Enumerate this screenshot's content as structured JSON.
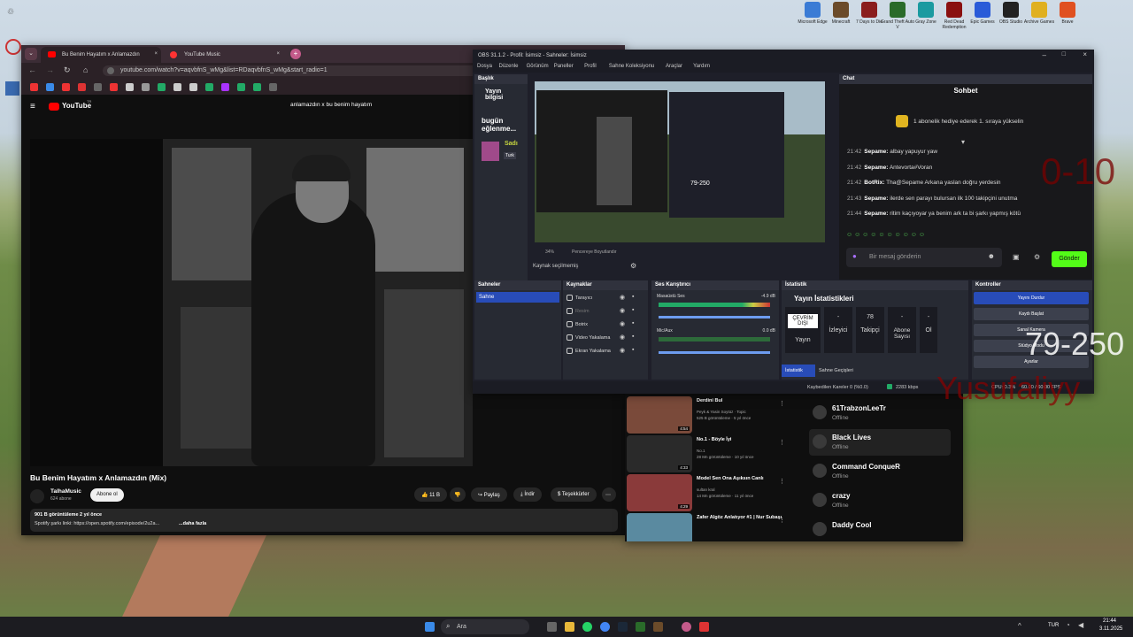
{
  "desktop": {
    "icons": [
      {
        "label": "Microsoft Edge",
        "color": "#3a7bd5"
      },
      {
        "label": "Minecraft",
        "color": "#6b4b2a"
      },
      {
        "label": "7 Days to Die",
        "color": "#8a1d1d"
      },
      {
        "label": "Grand Theft Auto V",
        "color": "#2a6b2a"
      },
      {
        "label": "Gray Zone",
        "color": "#1a9aa0"
      },
      {
        "label": "Red Dead Redemption",
        "color": "#8a1010"
      },
      {
        "label": "Epic Games",
        "color": "#2a5bd8"
      },
      {
        "label": "OBS Studio",
        "color": "#222"
      },
      {
        "label": "Archive Games",
        "color": "#e0b020"
      },
      {
        "label": "Brave",
        "color": "#e05020"
      }
    ]
  },
  "browser": {
    "tab1": "Bu Benim Hayatım x Anlamazdın",
    "tab2": "YouTube Music",
    "url": "youtube.com/watch?v=aqvbfnS_wMg&list=RDaqvbfnS_wMg&start_radio=1",
    "yt_logo": "YouTube",
    "yt_country": "TR",
    "playlist_title": "anlamazdın x bu benim hayatım",
    "video_title": "Bu Benim Hayatım x Anlamazdın (Mix)",
    "channel": "TalhaMusic",
    "subs": "624 abone",
    "subscribe": "Abone ol",
    "likes": "11 B",
    "share": "Paylaş",
    "download": "İndir",
    "thanks": "Teşekkürler",
    "views": "901 B görüntüleme  2 yıl önce",
    "desc": "Spotify şarkı linki: https://open.spotify.com/episode/2u2a...",
    "more": "...daha fazla"
  },
  "obs": {
    "title": "OBS 31.1.2 - Profil: İsimsiz - Sahneler: İsimsiz",
    "menu": [
      "Dosya",
      "Düzenle",
      "Görünüm",
      "Paneller",
      "Profil",
      "Sahne Koleksiyonu",
      "Araçlar",
      "Yardım"
    ],
    "baslik": "Başlık",
    "yayin_bilgisi": "Yayın bilgisi",
    "bugun": "bugün eğlenme...",
    "side_label1": "Sadı",
    "side_label2": "Turk",
    "zoom": "34%",
    "window_size": "Pencereye Boyutlandır",
    "no_source": "Kaynak seçilmemiş",
    "scenes_h": "Sahneler",
    "scene1": "Sahne",
    "sources_h": "Kaynaklar",
    "sources": [
      "Tarayıcı",
      "Resim",
      "Botrix",
      "Video Yakalama",
      "Ekran Yakalama"
    ],
    "mixer_h": "Ses Karıştırıcı",
    "mix1": "Masaüstü Ses",
    "mix1db": "-4.9 dB",
    "mix2": "Mic/Aux",
    "mix2db": "0.0 dB",
    "stats_h": "İstatistik",
    "stats_title": "Yayın İstatistikleri",
    "stat_status": "ÇEVRİM DIŞI",
    "stat_yayin": "Yayın",
    "stat1v": "-",
    "stat1l": "İzleyici",
    "stat2v": "78",
    "stat2l": "Takipçi",
    "stat3v": "-",
    "stat3l": "Abone Sayısı",
    "stat4v": "-",
    "stat4l": "Ol",
    "tab_stats": "İstatistik",
    "tab_trans": "Sahne Geçişleri",
    "controls_h": "Kontroller",
    "controls": [
      "Yayını Durdur",
      "Kaydı Başlat",
      "Sanal Kamera",
      "Stüdyo Modu",
      "Ayarlar"
    ],
    "status_bar": "Kaybedilen Kareler 0 (%0.0)",
    "kbps": "2283 kbps",
    "cpu": "CPU: 0.3%",
    "fps": "60.00 / 60.00 FPS"
  },
  "chat": {
    "header": "Chat",
    "title": "Sohbet",
    "banner": "1 abonelik hediye ederek 1. sıraya yükselin",
    "messages": [
      {
        "time": "21:42",
        "name": "Sepame:",
        "text": "albay yapuyur yaw"
      },
      {
        "time": "21:42",
        "name": "Sepame:",
        "text": "Antevorta#Voran"
      },
      {
        "time": "21:42",
        "name": "BotRix:",
        "text": "Tha@Sepame Arkana yaslan doğru yerdesin"
      },
      {
        "time": "21:43",
        "name": "Sepame:",
        "text": "ilerde sen parayı bulursan ilk 100 takipçini unutma"
      },
      {
        "time": "21:44",
        "name": "Sepame:",
        "text": "ritim kaçıyoyar ya benim ark ta bi şarkı yapmış kötü"
      }
    ],
    "placeholder": "Bir mesaj gönderin",
    "send": "Gönder"
  },
  "overlay": {
    "range1": "0-10",
    "range2": "79-250",
    "name": "Yusufaliyy"
  },
  "suggestions": [
    {
      "title": "Derdini Bul",
      "sub": "Peyk & Yasin Soytüz · Topic\n525 B görüntüleme · 5 yıl önce",
      "dur": "4:54",
      "color": "#7a4a3a"
    },
    {
      "title": "No.1 - Böyle İyi",
      "sub": "No.1\n28 Mn görüntüleme · 10 yıl önce",
      "dur": "4:33",
      "color": "#2a2a2a"
    },
    {
      "title": "Model  Sen Ona Aşıksın Canlı",
      "sub": "sultan kral\n14 Mn görüntüleme · 11 yıl önce",
      "dur": "4:29",
      "color": "#8a3a3a"
    },
    {
      "title": "Zafer Algöz Anlatıyor #1 | Nur Subaşı",
      "sub": "",
      "dur": "",
      "color": "#5a8aa0"
    }
  ],
  "friends": [
    {
      "name": "61TrabzonLeeTr",
      "status": "Offline"
    },
    {
      "name": "Black Lives",
      "status": "Offline"
    },
    {
      "name": "Command ConqueR",
      "status": "Offline"
    },
    {
      "name": "crazy",
      "status": "Offline"
    },
    {
      "name": "Daddy Cool",
      "status": ""
    }
  ],
  "taskbar": {
    "search": "Ara",
    "lang": "TUR",
    "time": "21:44",
    "date": "3.11.2025"
  }
}
